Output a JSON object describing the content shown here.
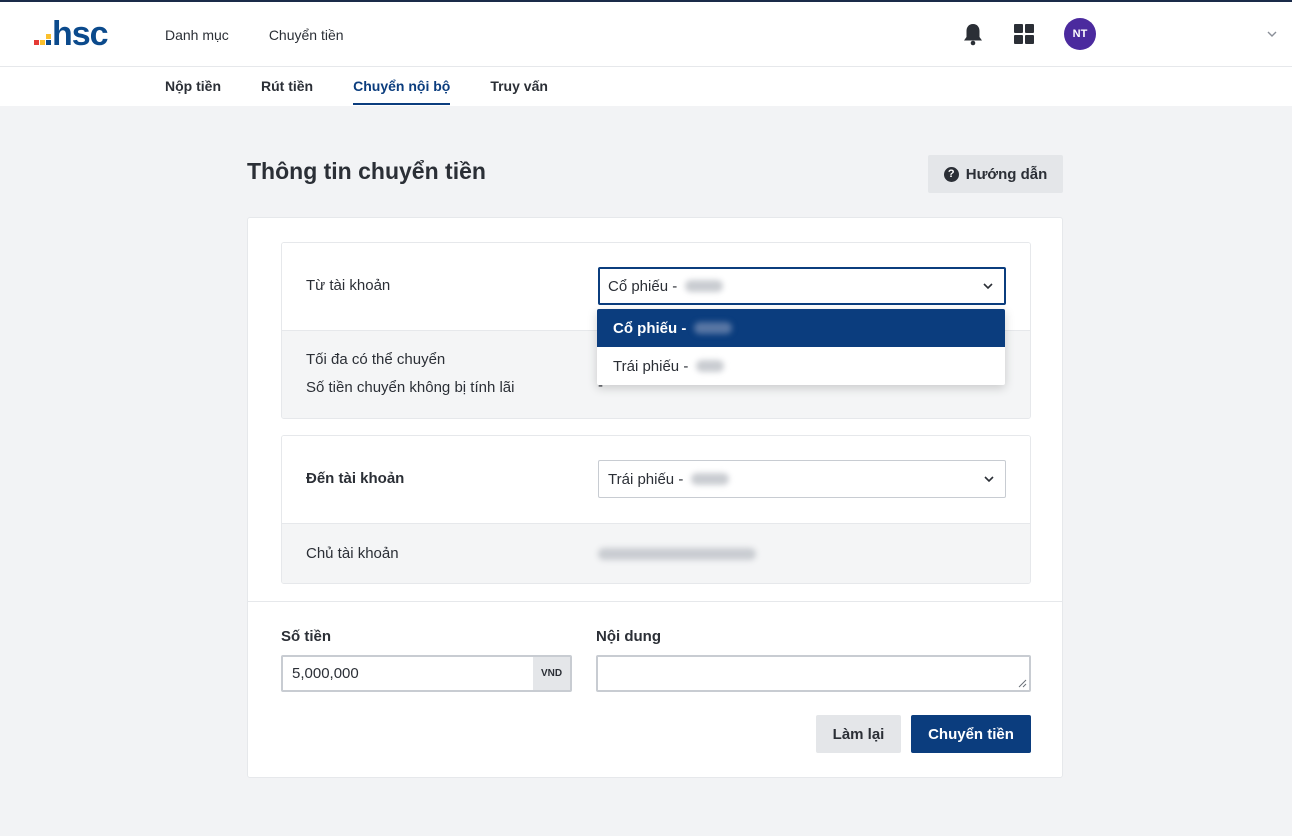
{
  "brand": {
    "logo_text": "hsc",
    "logo_dot_colors": [
      "#e53935",
      "#fbc02d",
      "#0b4a8c"
    ]
  },
  "top_nav": {
    "items": [
      "Danh mục",
      "Chuyển tiền"
    ]
  },
  "user": {
    "initials": "NT"
  },
  "sub_nav": {
    "items": [
      "Nộp tiền",
      "Rút tiền",
      "Chuyển nội bộ",
      "Truy vấn"
    ],
    "active": "Chuyển nội bộ"
  },
  "page": {
    "title": "Thông tin chuyển tiền",
    "guide_label": "Hướng dẫn"
  },
  "from_account": {
    "label": "Từ tài khoản",
    "selected": "Cổ phiếu -",
    "options": [
      "Cổ phiếu -",
      "Trái phiếu -"
    ],
    "max_label": "Tối đa có thể chuyển",
    "nointerest_label": "Số tiền chuyển không bị tính lãi",
    "nointerest_value": "-"
  },
  "to_account": {
    "label": "Đến tài khoản",
    "selected": "Trái phiếu -",
    "owner_label": "Chủ tài khoản"
  },
  "form": {
    "amount_label": "Số tiền",
    "amount_value": "5,000,000",
    "amount_unit": "VND",
    "content_label": "Nội dung",
    "reset_label": "Làm lại",
    "submit_label": "Chuyển tiền"
  },
  "colors": {
    "primary": "#0b3d7e",
    "accent": "#4b2a9e"
  }
}
